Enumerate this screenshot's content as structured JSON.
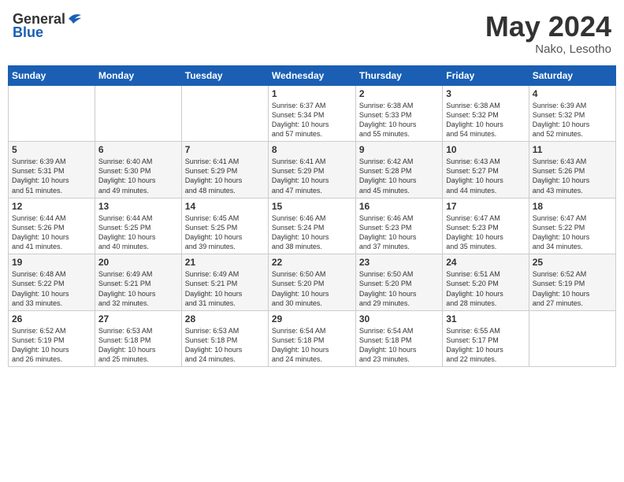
{
  "header": {
    "logo_general": "General",
    "logo_blue": "Blue",
    "month": "May 2024",
    "location": "Nako, Lesotho"
  },
  "days_of_week": [
    "Sunday",
    "Monday",
    "Tuesday",
    "Wednesday",
    "Thursday",
    "Friday",
    "Saturday"
  ],
  "weeks": [
    [
      {
        "day": "",
        "info": ""
      },
      {
        "day": "",
        "info": ""
      },
      {
        "day": "",
        "info": ""
      },
      {
        "day": "1",
        "info": "Sunrise: 6:37 AM\nSunset: 5:34 PM\nDaylight: 10 hours\nand 57 minutes."
      },
      {
        "day": "2",
        "info": "Sunrise: 6:38 AM\nSunset: 5:33 PM\nDaylight: 10 hours\nand 55 minutes."
      },
      {
        "day": "3",
        "info": "Sunrise: 6:38 AM\nSunset: 5:32 PM\nDaylight: 10 hours\nand 54 minutes."
      },
      {
        "day": "4",
        "info": "Sunrise: 6:39 AM\nSunset: 5:32 PM\nDaylight: 10 hours\nand 52 minutes."
      }
    ],
    [
      {
        "day": "5",
        "info": "Sunrise: 6:39 AM\nSunset: 5:31 PM\nDaylight: 10 hours\nand 51 minutes."
      },
      {
        "day": "6",
        "info": "Sunrise: 6:40 AM\nSunset: 5:30 PM\nDaylight: 10 hours\nand 49 minutes."
      },
      {
        "day": "7",
        "info": "Sunrise: 6:41 AM\nSunset: 5:29 PM\nDaylight: 10 hours\nand 48 minutes."
      },
      {
        "day": "8",
        "info": "Sunrise: 6:41 AM\nSunset: 5:29 PM\nDaylight: 10 hours\nand 47 minutes."
      },
      {
        "day": "9",
        "info": "Sunrise: 6:42 AM\nSunset: 5:28 PM\nDaylight: 10 hours\nand 45 minutes."
      },
      {
        "day": "10",
        "info": "Sunrise: 6:43 AM\nSunset: 5:27 PM\nDaylight: 10 hours\nand 44 minutes."
      },
      {
        "day": "11",
        "info": "Sunrise: 6:43 AM\nSunset: 5:26 PM\nDaylight: 10 hours\nand 43 minutes."
      }
    ],
    [
      {
        "day": "12",
        "info": "Sunrise: 6:44 AM\nSunset: 5:26 PM\nDaylight: 10 hours\nand 41 minutes."
      },
      {
        "day": "13",
        "info": "Sunrise: 6:44 AM\nSunset: 5:25 PM\nDaylight: 10 hours\nand 40 minutes."
      },
      {
        "day": "14",
        "info": "Sunrise: 6:45 AM\nSunset: 5:25 PM\nDaylight: 10 hours\nand 39 minutes."
      },
      {
        "day": "15",
        "info": "Sunrise: 6:46 AM\nSunset: 5:24 PM\nDaylight: 10 hours\nand 38 minutes."
      },
      {
        "day": "16",
        "info": "Sunrise: 6:46 AM\nSunset: 5:23 PM\nDaylight: 10 hours\nand 37 minutes."
      },
      {
        "day": "17",
        "info": "Sunrise: 6:47 AM\nSunset: 5:23 PM\nDaylight: 10 hours\nand 35 minutes."
      },
      {
        "day": "18",
        "info": "Sunrise: 6:47 AM\nSunset: 5:22 PM\nDaylight: 10 hours\nand 34 minutes."
      }
    ],
    [
      {
        "day": "19",
        "info": "Sunrise: 6:48 AM\nSunset: 5:22 PM\nDaylight: 10 hours\nand 33 minutes."
      },
      {
        "day": "20",
        "info": "Sunrise: 6:49 AM\nSunset: 5:21 PM\nDaylight: 10 hours\nand 32 minutes."
      },
      {
        "day": "21",
        "info": "Sunrise: 6:49 AM\nSunset: 5:21 PM\nDaylight: 10 hours\nand 31 minutes."
      },
      {
        "day": "22",
        "info": "Sunrise: 6:50 AM\nSunset: 5:20 PM\nDaylight: 10 hours\nand 30 minutes."
      },
      {
        "day": "23",
        "info": "Sunrise: 6:50 AM\nSunset: 5:20 PM\nDaylight: 10 hours\nand 29 minutes."
      },
      {
        "day": "24",
        "info": "Sunrise: 6:51 AM\nSunset: 5:20 PM\nDaylight: 10 hours\nand 28 minutes."
      },
      {
        "day": "25",
        "info": "Sunrise: 6:52 AM\nSunset: 5:19 PM\nDaylight: 10 hours\nand 27 minutes."
      }
    ],
    [
      {
        "day": "26",
        "info": "Sunrise: 6:52 AM\nSunset: 5:19 PM\nDaylight: 10 hours\nand 26 minutes."
      },
      {
        "day": "27",
        "info": "Sunrise: 6:53 AM\nSunset: 5:18 PM\nDaylight: 10 hours\nand 25 minutes."
      },
      {
        "day": "28",
        "info": "Sunrise: 6:53 AM\nSunset: 5:18 PM\nDaylight: 10 hours\nand 24 minutes."
      },
      {
        "day": "29",
        "info": "Sunrise: 6:54 AM\nSunset: 5:18 PM\nDaylight: 10 hours\nand 24 minutes."
      },
      {
        "day": "30",
        "info": "Sunrise: 6:54 AM\nSunset: 5:18 PM\nDaylight: 10 hours\nand 23 minutes."
      },
      {
        "day": "31",
        "info": "Sunrise: 6:55 AM\nSunset: 5:17 PM\nDaylight: 10 hours\nand 22 minutes."
      },
      {
        "day": "",
        "info": ""
      }
    ]
  ]
}
